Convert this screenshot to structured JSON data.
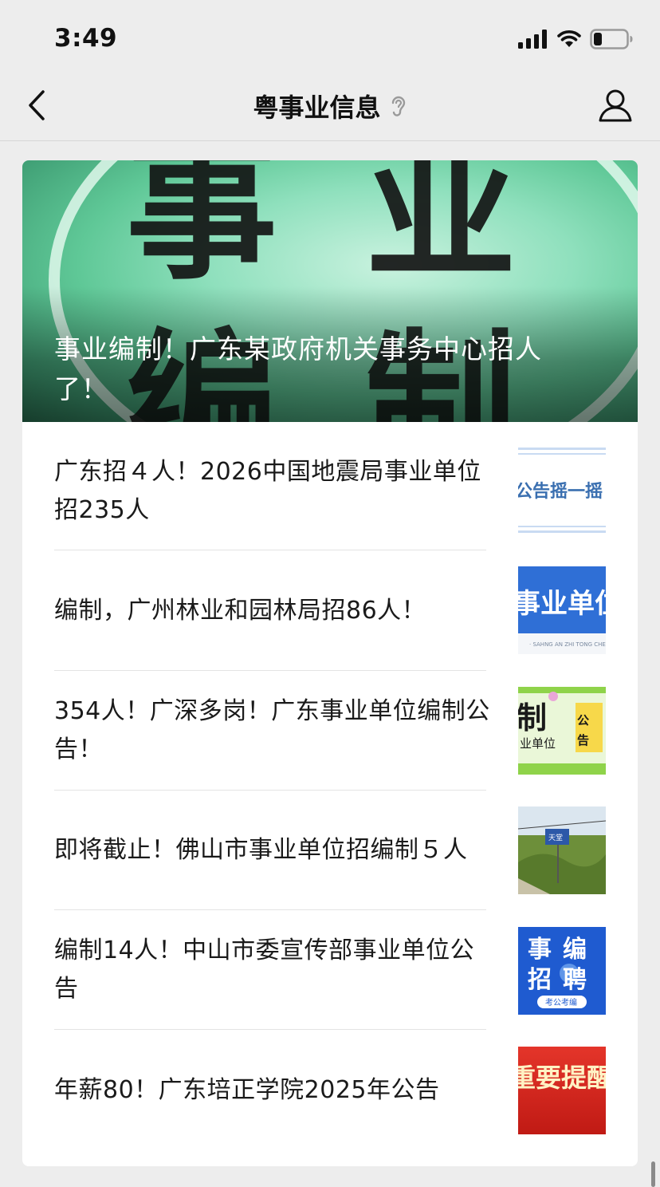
{
  "status_bar": {
    "time": "3:49",
    "battery_level": 0.25
  },
  "nav": {
    "title": "粤事业信息"
  },
  "hero": {
    "title": "事业编制！广东某政府机关事务中心招人了！",
    "overlay_text": "事业编制"
  },
  "articles": [
    {
      "title": "广东招４人！2026中国地震局事业单位招235人",
      "thumb_text": "公告摇一摇"
    },
    {
      "title": "编制，广州林业和园林局招86人！",
      "thumb_text": "事业单位",
      "thumb_subtext": "· SAHNG AN ZHI TONG CHE ·"
    },
    {
      "title": "354人！广深多岗！广东事业单位编制公告！",
      "thumb_text": "制",
      "thumb_text2": "公告",
      "thumb_subtext": "业单位"
    },
    {
      "title": "即将截止！佛山市事业单位招编制５人",
      "thumb_text": "天堂"
    },
    {
      "title": "编制14人！中山市委宣传部事业单位公告",
      "thumb_text": "事编",
      "thumb_text2": "招聘",
      "thumb_subtext": "考公考编"
    },
    {
      "title": "年薪80！广东培正学院2025年公告",
      "thumb_text": "重要提醒"
    }
  ],
  "colors": {
    "background": "#ededed",
    "card": "#ffffff",
    "hero_green": "#5fc897",
    "thumb_blue": "#2f6fd6",
    "thumb_red": "#d8241c"
  }
}
